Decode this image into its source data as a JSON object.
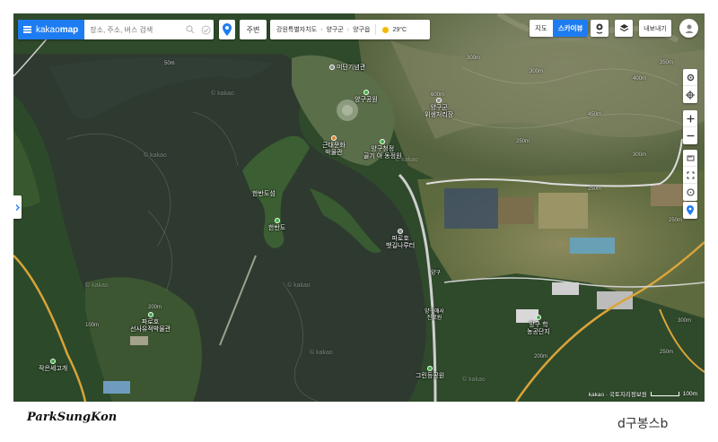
{
  "search": {
    "brand_strong": "kakao",
    "brand_light": "map",
    "placeholder": "장소, 주소, 버스 검색"
  },
  "around_label": "주변",
  "breadcrumb": {
    "province": "강원특별자치도",
    "county": "양구군",
    "town": "양구읍",
    "temperature": "29°C"
  },
  "map_type": {
    "map": "지도",
    "skyview": "스카이뷰"
  },
  "export_label": "내보내기",
  "labels": {
    "cycling": "미딘기념관",
    "park": "양구공원",
    "health_center": "양구군\n위생처리장",
    "museum": "근대문화\n박물관",
    "sports": "양구청정\n골기 아 동정원",
    "island": "한반도섬",
    "island_poi": "한반도",
    "boardwalk": "파로호\n뱃길나루터",
    "dam": "파로호",
    "road": "양구",
    "complex": "양구 학\n농공단지",
    "memorial": "양구애사\n진료원",
    "cultural": "그린등공원",
    "culture_hall": "파로호\n선사유적박물관",
    "pass": "작은세고개"
  },
  "elevations": [
    "50m",
    "300m",
    "300m",
    "350m",
    "450m",
    "600m",
    "250m",
    "250m",
    "300m",
    "100m",
    "200m",
    "200m",
    "250m",
    "300m",
    "250m",
    "400m"
  ],
  "watermarks": [
    "© kakao",
    "© kakao",
    "© kakao",
    "© kakao",
    "© kakao",
    "© kakao",
    "© kakao"
  ],
  "scale": {
    "copyright": "kakao · 국토지리정보원",
    "distance": "100m"
  },
  "signature_left": "ParkSungKon",
  "signature_right": "d구봉스b",
  "colors": {
    "accent": "#1e7cf2",
    "water": "#2f3b31",
    "forest": "#2f4f2c"
  }
}
